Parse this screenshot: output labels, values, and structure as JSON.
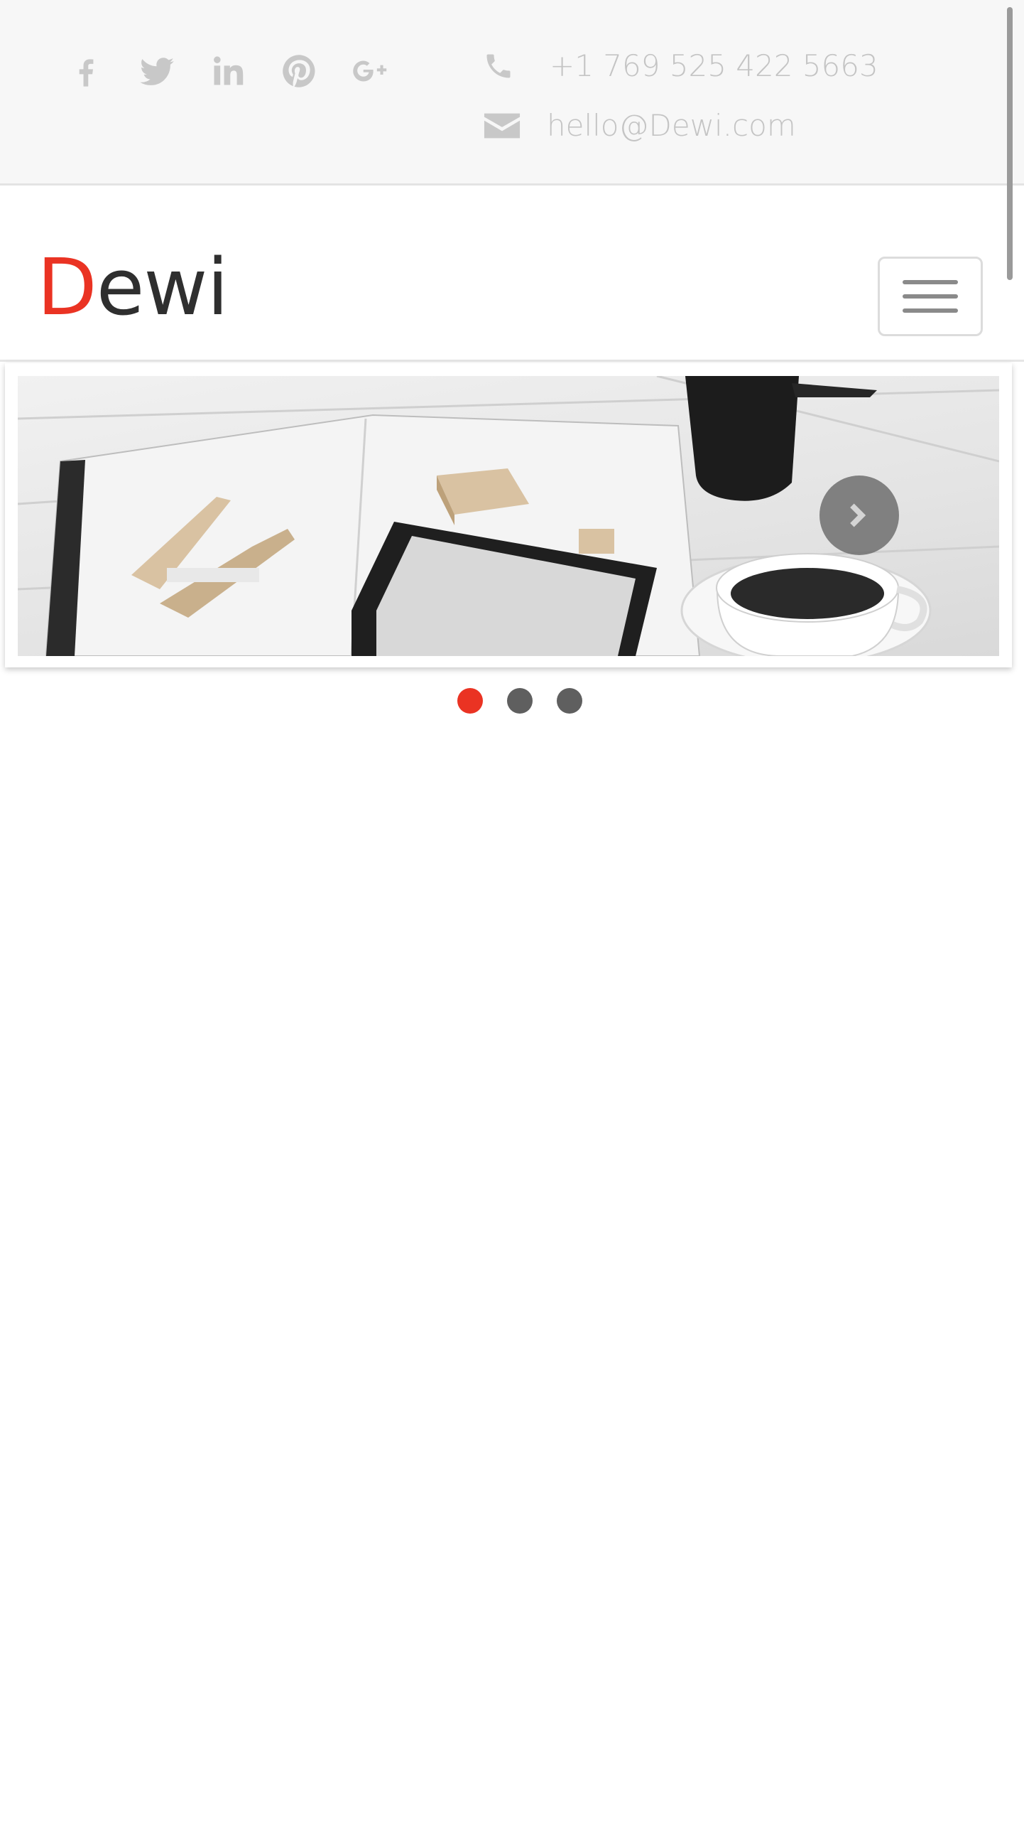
{
  "topbar": {
    "social": [
      {
        "icon": "facebook-icon"
      },
      {
        "icon": "twitter-icon"
      },
      {
        "icon": "linkedin-icon"
      },
      {
        "icon": "pinterest-icon"
      },
      {
        "icon": "google-plus-icon"
      }
    ],
    "phone": "+1 769 525 422 5663",
    "email": "hello@Dewi.com"
  },
  "navbar": {
    "logo_first": "D",
    "logo_rest": "ewi",
    "menu_icon": "hamburger-menu-icon"
  },
  "slider": {
    "next_icon": "chevron-right-icon",
    "dots": [
      {
        "active": true
      },
      {
        "active": false
      },
      {
        "active": false
      }
    ]
  },
  "colors": {
    "accent": "#ea3323",
    "icon_gray": "#c8c8c8",
    "text_dark": "#2f2f2f",
    "topbar_bg": "#f7f7f7"
  }
}
